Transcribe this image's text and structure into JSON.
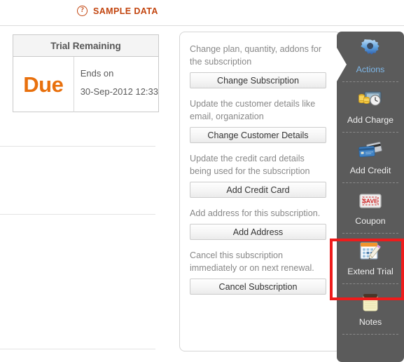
{
  "header": {
    "help_icon": "question-mark-icon",
    "label": "SAMPLE DATA",
    "accent_color": "#c2440e"
  },
  "trial_card": {
    "title": "Trial Remaining",
    "status": "Due",
    "status_color": "#e8700d",
    "ends_label": "Ends on",
    "ends_value": "30-Sep-2012 12:33"
  },
  "main_panel": {
    "actions": [
      {
        "description": "Change plan, quantity, addons for the subscription",
        "button_label": "Change Subscription"
      },
      {
        "description": "Update the customer details like email, organization",
        "button_label": "Change Customer Details"
      },
      {
        "description": "Update the credit card details being used for the subscription",
        "button_label": "Add Credit Card"
      },
      {
        "description": "Add address for this subscription.",
        "button_label": "Add Address"
      },
      {
        "description": "Cancel this subscription immediately or on next renewal.",
        "button_label": "Cancel Subscription"
      }
    ]
  },
  "sidebar": {
    "background_color": "#5b5b5b",
    "active_label_color": "#7eb7e8",
    "items": [
      {
        "label": "Actions",
        "icon": "gear-icon",
        "active": true
      },
      {
        "label": "Add Charge",
        "icon": "money-clock-icon",
        "active": false
      },
      {
        "label": "Add Credit",
        "icon": "credit-card-icon",
        "active": false
      },
      {
        "label": "Coupon",
        "icon": "save-tag-icon",
        "active": false
      },
      {
        "label": "Extend Trial",
        "icon": "calendar-pencil-icon",
        "active": false
      },
      {
        "label": "Notes",
        "icon": "notepad-icon",
        "active": false
      }
    ]
  },
  "highlight": {
    "target": "Extend Trial",
    "color": "#ee1c1c"
  }
}
